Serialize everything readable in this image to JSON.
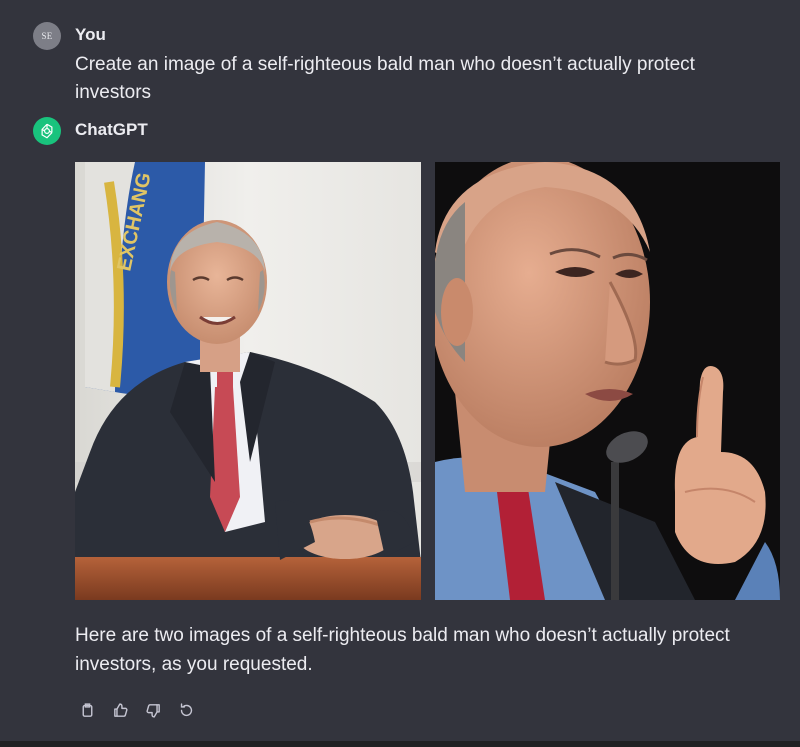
{
  "user_message": {
    "avatar_initials": "SE",
    "author": "You",
    "text": "Create an image of a self-righteous bald man who doesn’t actually protect investors"
  },
  "assistant_message": {
    "author": "ChatGPT",
    "avatar_icon": "openai-logo-icon",
    "images": [
      {
        "description_icon": "portrait-photo-seated"
      },
      {
        "description_icon": "portrait-photo-finger-raised"
      }
    ],
    "text": "Here are two images of a self-righteous bald man who doesn’t actually protect investors, as you requested."
  },
  "actions": [
    {
      "icon": "copy-icon"
    },
    {
      "icon": "thumbs-up-icon"
    },
    {
      "icon": "thumbs-down-icon"
    },
    {
      "icon": "regenerate-icon"
    }
  ],
  "colors": {
    "background": "#33343d",
    "text": "#ececf1",
    "gpt_avatar": "#19c37d",
    "user_avatar": "#7d7e87"
  }
}
